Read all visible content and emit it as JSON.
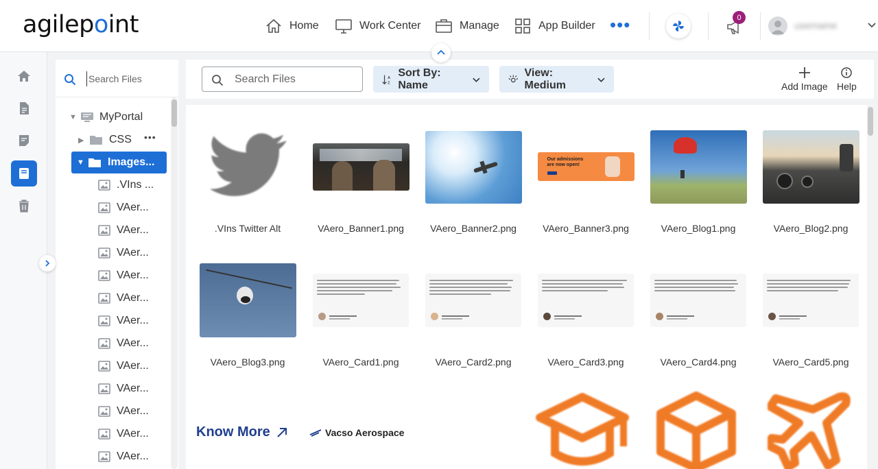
{
  "brand": {
    "logo_text": "agilepoint"
  },
  "nav": {
    "home": "Home",
    "work_center": "Work Center",
    "manage": "Manage",
    "app_builder": "App Builder",
    "more": "•••"
  },
  "notifications": {
    "count": "0"
  },
  "user": {
    "name": "username"
  },
  "tree": {
    "search_placeholder": "Search Files",
    "root": "MyPortal",
    "folders": [
      {
        "label": "CSS",
        "more": "•••"
      },
      {
        "label": "Images..."
      }
    ],
    "files": [
      ".VIns ...",
      "VAer...",
      "VAer...",
      "VAer...",
      "VAer...",
      "VAer...",
      "VAer...",
      "VAer...",
      "VAer...",
      "VAer...",
      "VAer...",
      "VAer...",
      "VAer..."
    ]
  },
  "toolbar": {
    "search_placeholder": "Search Files",
    "sort_label": "Sort By: Name",
    "view_label": "View: Medium",
    "add_image": "Add Image",
    "help": "Help"
  },
  "gallery": {
    "items": [
      ".VIns Twitter Alt",
      "VAero_Banner1.png",
      "VAero_Banner2.png",
      "VAero_Banner3.png",
      "VAero_Blog1.png",
      "VAero_Blog2.png",
      "VAero_Blog3.png",
      "VAero_Card1.png",
      "VAero_Card2.png",
      "VAero_Card3.png",
      "VAero_Card4.png",
      "VAero_Card5.png"
    ],
    "banner3_text": "Our admissions are now open!",
    "know_more": "Know More",
    "vacso": "Vacso Aerospace"
  },
  "colors": {
    "accent": "#1d6fd6",
    "badge": "#9c1f7a",
    "orange": "#f07b26"
  }
}
